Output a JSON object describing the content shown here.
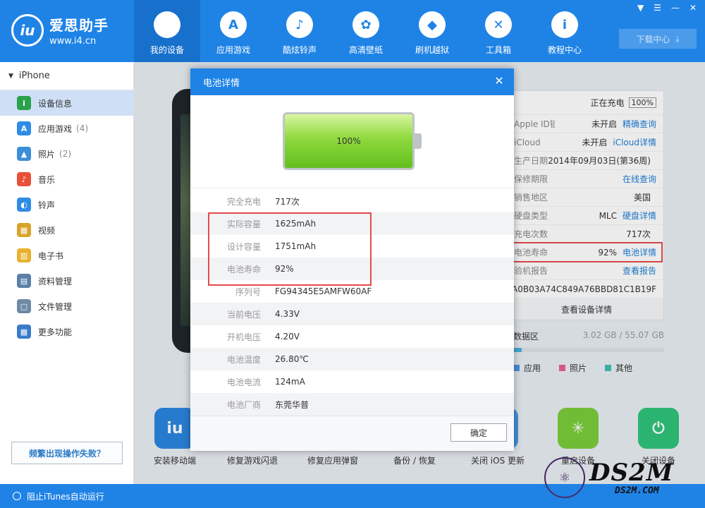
{
  "app": {
    "logo_text": "iu",
    "name": "爱思助手",
    "url": "www.i4.cn"
  },
  "nav": [
    {
      "label": "我的设备",
      "icon": "apple-icon",
      "glyph": ""
    },
    {
      "label": "应用游戏",
      "icon": "app-store-icon",
      "glyph": "A"
    },
    {
      "label": "酷炫铃声",
      "icon": "bell-icon",
      "glyph": "♪"
    },
    {
      "label": "高清壁纸",
      "icon": "flower-icon",
      "glyph": "✿"
    },
    {
      "label": "刷机越狱",
      "icon": "box-icon",
      "glyph": "◆"
    },
    {
      "label": "工具箱",
      "icon": "tools-icon",
      "glyph": "✕"
    },
    {
      "label": "教程中心",
      "icon": "info-icon",
      "glyph": "i"
    }
  ],
  "download_center": "下载中心",
  "sidebar": {
    "device": "iPhone",
    "items": [
      {
        "label": "设备信息",
        "count": "",
        "icon": "info-icon",
        "color": "#2aa14b",
        "glyph": "i"
      },
      {
        "label": "应用游戏",
        "count": "(4)",
        "icon": "app-store-icon",
        "color": "#2f8ce6",
        "glyph": "A"
      },
      {
        "label": "照片",
        "count": "(2)",
        "icon": "photo-icon",
        "color": "#3c8fd9",
        "glyph": "▲"
      },
      {
        "label": "音乐",
        "count": "",
        "icon": "music-icon",
        "color": "#e8503a",
        "glyph": "♪"
      },
      {
        "label": "铃声",
        "count": "",
        "icon": "bell-icon",
        "color": "#2f8ce6",
        "glyph": "◐"
      },
      {
        "label": "视频",
        "count": "",
        "icon": "video-icon",
        "color": "#d9a32b",
        "glyph": "▦"
      },
      {
        "label": "电子书",
        "count": "",
        "icon": "book-icon",
        "color": "#e8b12e",
        "glyph": "▥"
      },
      {
        "label": "资料管理",
        "count": "",
        "icon": "contacts-icon",
        "color": "#5a7fa8",
        "glyph": "▤"
      },
      {
        "label": "文件管理",
        "count": "",
        "icon": "file-icon",
        "color": "#6e8aa6",
        "glyph": "▢"
      },
      {
        "label": "更多功能",
        "count": "",
        "icon": "grid-icon",
        "color": "#3a7bc8",
        "glyph": "▦"
      }
    ],
    "help": "频繁出现操作失败？"
  },
  "footer": {
    "itunes": "阻止iTunes自动运行"
  },
  "info": {
    "charging": "正在充电",
    "charge_pct": "100%",
    "rows": [
      {
        "k": "Apple ID锁",
        "v": "未开启",
        "l": "精确查询"
      },
      {
        "k": "iCloud",
        "v": "未开启",
        "l": "iCloud详情"
      },
      {
        "k": "生产日期",
        "v": "2014年09月03日(第36周)",
        "l": ""
      },
      {
        "k": "保修期限",
        "v": "",
        "l": "在线查询"
      },
      {
        "k": "销售地区",
        "v": "美国",
        "l": ""
      },
      {
        "k": "硬盘类型",
        "v": "MLC",
        "l": "硬盘详情"
      },
      {
        "k": "充电次数",
        "v": "717次",
        "l": ""
      },
      {
        "k": "电池寿命",
        "v": "92%",
        "l": "电池详情"
      },
      {
        "k": "验机报告",
        "v": "",
        "l": "查看报告"
      }
    ],
    "serial": "CA0B03A74C849A76BBD81C1B19F",
    "detail_link": "查看设备详情"
  },
  "storage": {
    "title": "数据区",
    "usage": "3.02 GB / 55.07 GB",
    "used_fraction": 0.055,
    "legend": [
      {
        "label": "应用",
        "color": "#4a9be6"
      },
      {
        "label": "照片",
        "color": "#e6609a"
      },
      {
        "label": "其他",
        "color": "#3fbfb0"
      }
    ]
  },
  "tools": [
    {
      "label": "安装移动端",
      "icon": "i4-app-icon",
      "color": "#2b86e0",
      "glyph": "iu"
    },
    {
      "label": "修复游戏闪退",
      "icon": "game-icon",
      "color": "#4a9be6",
      "glyph": ""
    },
    {
      "label": "修复应用弹窗",
      "icon": "app-icon",
      "color": "#4a9be6",
      "glyph": ""
    },
    {
      "label": "备份 / 恢复",
      "icon": "backup-icon",
      "color": "#4a9be6",
      "glyph": ""
    },
    {
      "label": "关闭 iOS 更新",
      "icon": "ios-update-icon",
      "color": "#4a9be6",
      "glyph": ""
    },
    {
      "label": "重启设备",
      "icon": "restart-icon",
      "color": "#7bcc3a",
      "glyph": "✳"
    },
    {
      "label": "关闭设备",
      "icon": "power-icon",
      "color": "#2ec47a",
      "glyph": "⏻"
    }
  ],
  "dialog": {
    "title": "电池详情",
    "close": "✕",
    "battery_level": "100%",
    "rows": [
      {
        "k": "完全充电",
        "v": "717次"
      },
      {
        "k": "实际容量",
        "v": "1625mAh"
      },
      {
        "k": "设计容量",
        "v": "1751mAh"
      },
      {
        "k": "电池寿命",
        "v": "92%"
      },
      {
        "k": "序列号",
        "v": "FG94345E5AMFW60AF"
      },
      {
        "k": "当前电压",
        "v": "4.33V"
      },
      {
        "k": "开机电压",
        "v": "4.20V"
      },
      {
        "k": "电池温度",
        "v": "26.80℃"
      },
      {
        "k": "电池电流",
        "v": "124mA"
      },
      {
        "k": "电池厂商",
        "v": "东莞华普"
      }
    ],
    "ok": "确定"
  },
  "watermark": {
    "big": "DS2M",
    "small": "DS2M.COM"
  }
}
